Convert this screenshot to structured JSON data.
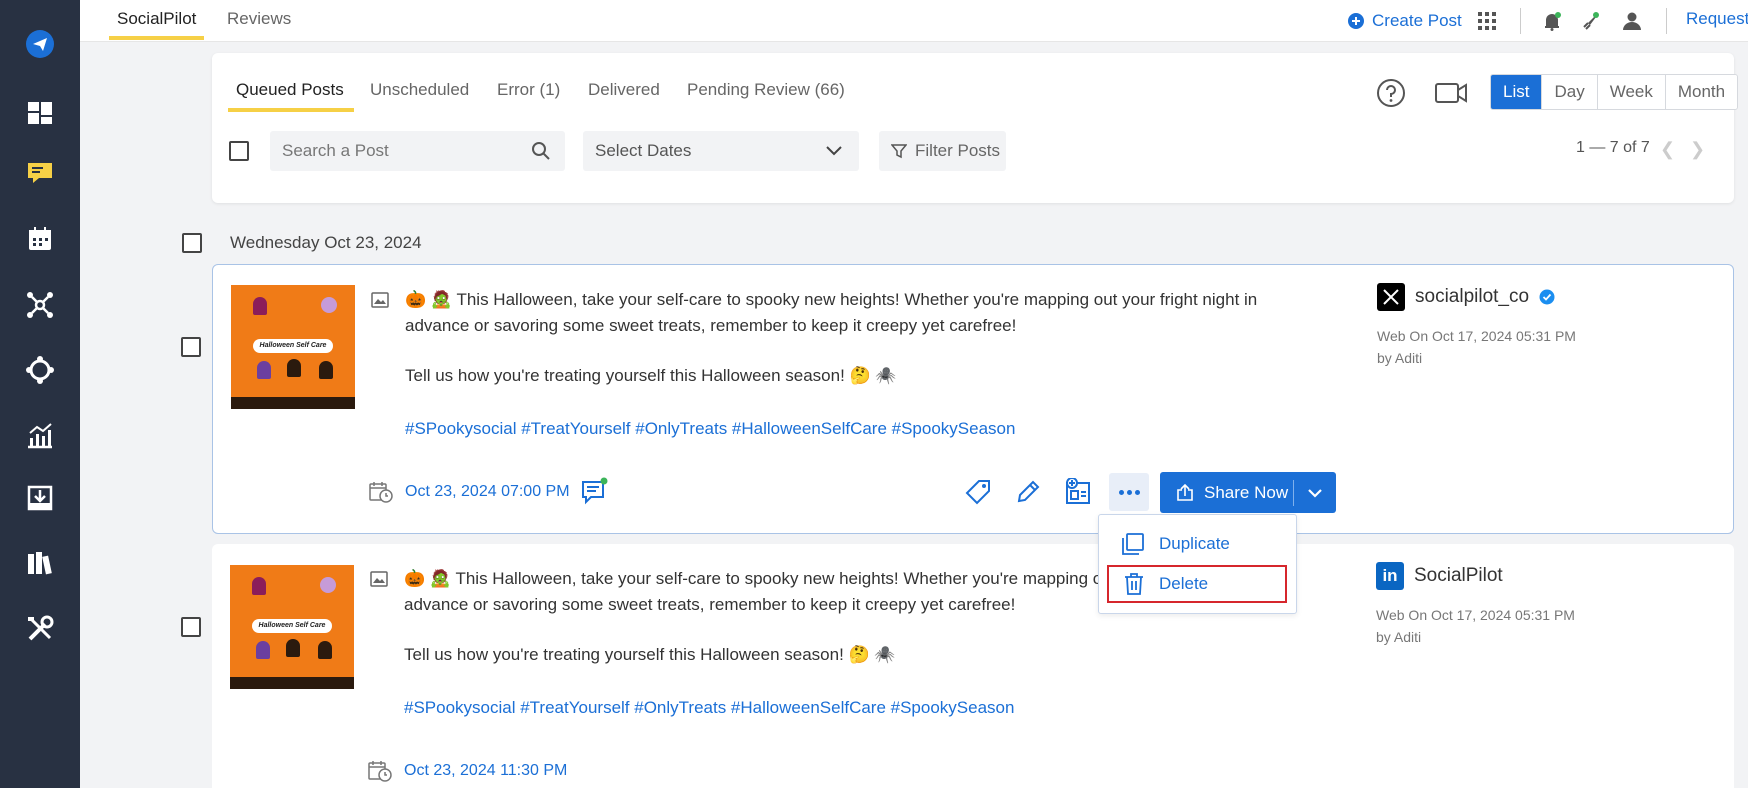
{
  "top_tabs": [
    {
      "label": "SocialPilot",
      "active": true
    },
    {
      "label": "Reviews",
      "active": false
    }
  ],
  "topbar": {
    "create_post_label": "Create Post",
    "request_label": "Request"
  },
  "queue_tabs": [
    {
      "label": "Queued Posts",
      "active": true
    },
    {
      "label": "Unscheduled",
      "active": false
    },
    {
      "label": "Error (1)",
      "active": false
    },
    {
      "label": "Delivered",
      "active": false
    },
    {
      "label": "Pending Review (66)",
      "active": false
    }
  ],
  "view_modes": [
    {
      "label": "List",
      "active": true
    },
    {
      "label": "Day",
      "active": false
    },
    {
      "label": "Week",
      "active": false
    },
    {
      "label": "Month",
      "active": false
    }
  ],
  "search": {
    "placeholder": "Search a Post"
  },
  "date_select": {
    "label": "Select Dates"
  },
  "filter": {
    "label": "Filter Posts"
  },
  "pagination": {
    "text": "1 — 7 of 7"
  },
  "day_header": "Wednesday Oct 23, 2024",
  "posts": [
    {
      "line1": "🎃 🧟 This Halloween, take your self-care to spooky new heights! Whether you're mapping out your fright night in advance or savoring some sweet treats, remember to keep it creepy yet carefree!",
      "line2": "Tell us how you're treating yourself this Halloween season! 🤔 🕷️",
      "hashtags": "#SPookysocial #TreatYourself #OnlyTreats #HalloweenSelfCare #SpookySeason",
      "scheduled": "Oct 23, 2024 07:00 PM",
      "account": "socialpilot_co",
      "network": "X",
      "meta_line1": "Web On Oct 17, 2024 05:31 PM",
      "meta_line2": "by Aditi",
      "share_label": "Share Now",
      "thumb_title": "Halloween Self Care"
    },
    {
      "line1": "🎃 🧟 This Halloween, take your self-care to spooky new heights! Whether you're mapping out your fright night in advance or savoring some sweet treats, remember to keep it creepy yet carefree!",
      "line2": "Tell us how you're treating yourself this Halloween season! 🤔 🕷️",
      "hashtags": "#SPookysocial #TreatYourself #OnlyTreats #HalloweenSelfCare #SpookySeason",
      "scheduled": "Oct 23, 2024 11:30 PM",
      "account": "SocialPilot",
      "network": "LinkedIn",
      "meta_line1": "Web On Oct 17, 2024 05:31 PM",
      "meta_line2": "by Aditi",
      "thumb_title": "Halloween Self Care"
    }
  ],
  "more_menu": {
    "duplicate_label": "Duplicate",
    "delete_label": "Delete"
  },
  "colors": {
    "accent": "#1b6fd6",
    "sidebar": "#283142",
    "tab_underline": "#f6d046",
    "highlight": "#d6262c"
  }
}
